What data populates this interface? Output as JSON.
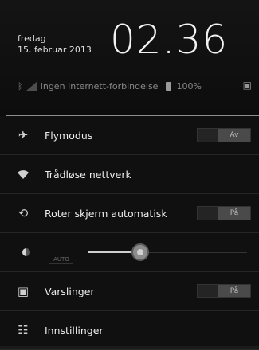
{
  "header": {
    "day": "fredag",
    "date": "15. februar 2013",
    "time": "02.36",
    "connection_status": "Ingen Internett-forbindelse",
    "battery_level": "100%",
    "icons": [
      "bluetooth-icon",
      "signal-icon",
      "battery-icon",
      "notification-icon"
    ]
  },
  "settings": [
    {
      "label": "Flymodus",
      "icon": "airplane-icon",
      "toggle": "Av",
      "toggle_state": "off"
    },
    {
      "label": "Trådløse nettverk",
      "icon": "wifi-icon"
    },
    {
      "label": "Roter skjerm automatisk",
      "icon": "rotate-icon",
      "toggle": "På",
      "toggle_state": "on"
    },
    {
      "label": "brightness",
      "icon": "brightness-icon",
      "auto_label": "AUTO",
      "level": 0.33
    },
    {
      "label": "Varslinger",
      "icon": "notification-icon",
      "toggle": "På",
      "toggle_state": "on"
    },
    {
      "label": "Innstillinger",
      "icon": "settings-sliders-icon"
    }
  ],
  "colors": {
    "background": "#0a0a0a",
    "text": "#ededed",
    "toggle_off": "#4a4a4a"
  }
}
